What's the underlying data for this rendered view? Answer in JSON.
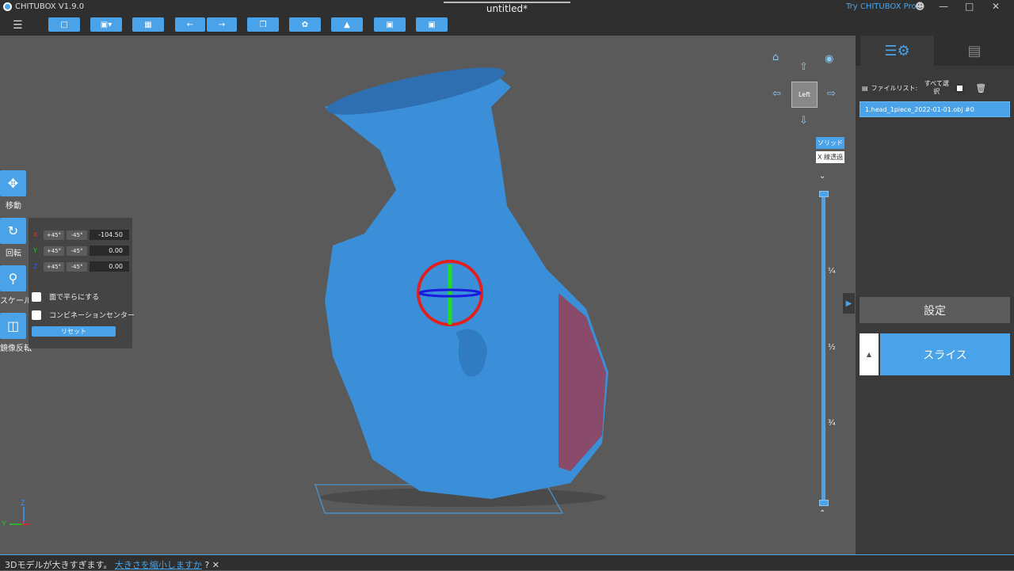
{
  "titlebar": {
    "app_name": "CHITUBOX V1.9.0",
    "document_title": "untitled*",
    "pro_link": "Try CHITUBOX Pro"
  },
  "toolbar": {
    "buttons": [
      "open-folder",
      "save",
      "import",
      "undo",
      "redo",
      "copy",
      "arrange",
      "support",
      "hollow",
      "slice-box"
    ]
  },
  "left_tools": {
    "move": "移動",
    "rotate": "回転",
    "scale": "スケール",
    "mirror": "鏡像反転"
  },
  "rotate_panel": {
    "x_label": "X",
    "y_label": "Y",
    "z_label": "Z",
    "plus45": "+45°",
    "minus45": "-45°",
    "x_value": "-104.50",
    "y_value": "0.00",
    "z_value": "0.00",
    "lay_flat": "面で平らにする",
    "combination_center": "コンビネーションセンター",
    "reset": "リセット"
  },
  "view": {
    "cube_label": "Left",
    "solid": "ソリッド",
    "wireframe": "X 線透過"
  },
  "slider": {
    "ticks": [
      "¼",
      "½",
      "¾"
    ]
  },
  "side_panel": {
    "file_list_label": "ファイルリスト:",
    "select_all": "すべて選択",
    "file_item": "1.head_1piece_2022-01-01.obj #0",
    "settings": "設定",
    "slice": "スライス"
  },
  "statusbar": {
    "message": "3Dモデルが大きすぎます。",
    "link": "大きさを縮小しますか",
    "question": "?"
  },
  "axes": {
    "x": "X",
    "y": "Y",
    "z": "Z"
  },
  "colors": {
    "accent": "#4aa3e8",
    "model": "#3a8fd8",
    "out_of_bounds": "#8a4a6a"
  }
}
